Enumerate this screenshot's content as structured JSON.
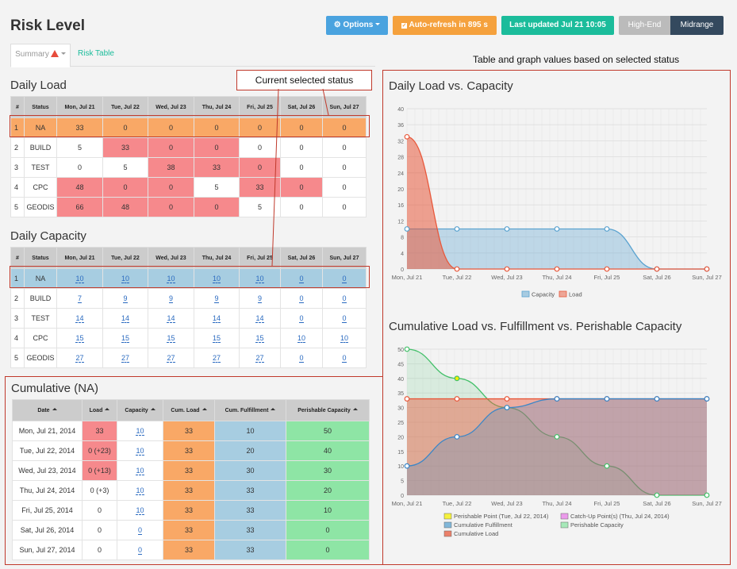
{
  "header": {
    "title": "Risk Level",
    "options_label": "Options",
    "autorefresh_label": "Auto-refresh in 895 s",
    "updated_label": "Last updated Jul 21 10:05",
    "highend_label": "High-End",
    "midrange_label": "Midrange"
  },
  "tabs": {
    "summary": "Summary",
    "risk_table": "Risk Table"
  },
  "annotations": {
    "note": "Table and graph values based on selected status",
    "callout": "Current selected status"
  },
  "daily_load": {
    "title": "Daily Load",
    "columns": [
      "#",
      "Status",
      "Mon, Jul 21",
      "Tue, Jul 22",
      "Wed, Jul 23",
      "Thu, Jul 24",
      "Fri, Jul 25",
      "Sat, Jul 26",
      "Sun, Jul 27"
    ],
    "rows": [
      {
        "n": "1",
        "status": "NA",
        "values": [
          "33",
          "0",
          "0",
          "0",
          "0",
          "0",
          "0"
        ],
        "risk": [
          1,
          1,
          1,
          1,
          1,
          1,
          1
        ]
      },
      {
        "n": "2",
        "status": "BUILD",
        "values": [
          "5",
          "33",
          "0",
          "0",
          "0",
          "0",
          "0"
        ],
        "risk": [
          0,
          1,
          1,
          1,
          0,
          0,
          0
        ]
      },
      {
        "n": "3",
        "status": "TEST",
        "values": [
          "0",
          "5",
          "38",
          "33",
          "0",
          "0",
          "0"
        ],
        "risk": [
          0,
          0,
          1,
          1,
          1,
          0,
          0
        ]
      },
      {
        "n": "4",
        "status": "CPC",
        "values": [
          "48",
          "0",
          "0",
          "5",
          "33",
          "0",
          "0"
        ],
        "risk": [
          1,
          1,
          1,
          0,
          1,
          1,
          0
        ]
      },
      {
        "n": "5",
        "status": "GEODIS",
        "values": [
          "66",
          "48",
          "0",
          "0",
          "5",
          "0",
          "0"
        ],
        "risk": [
          1,
          1,
          1,
          1,
          0,
          0,
          0
        ]
      }
    ]
  },
  "daily_capacity": {
    "title": "Daily Capacity",
    "columns": [
      "#",
      "Status",
      "Mon, Jul 21",
      "Tue, Jul 22",
      "Wed, Jul 23",
      "Thu, Jul 24",
      "Fri, Jul 25",
      "Sat, Jul 26",
      "Sun, Jul 27"
    ],
    "rows": [
      {
        "n": "1",
        "status": "NA",
        "values": [
          "10",
          "10",
          "10",
          "10",
          "10",
          "0",
          "0"
        ]
      },
      {
        "n": "2",
        "status": "BUILD",
        "values": [
          "7",
          "9",
          "9",
          "9",
          "9",
          "0",
          "0"
        ]
      },
      {
        "n": "3",
        "status": "TEST",
        "values": [
          "14",
          "14",
          "14",
          "14",
          "14",
          "0",
          "0"
        ]
      },
      {
        "n": "4",
        "status": "CPC",
        "values": [
          "15",
          "15",
          "15",
          "15",
          "15",
          "10",
          "10"
        ]
      },
      {
        "n": "5",
        "status": "GEODIS",
        "values": [
          "27",
          "27",
          "27",
          "27",
          "27",
          "0",
          "0"
        ]
      }
    ]
  },
  "cumulative": {
    "title": "Cumulative (NA)",
    "columns": [
      "Date",
      "Load",
      "Capacity",
      "Cum. Load",
      "Cum. Fulfillment",
      "Perishable Capacity"
    ],
    "rows": [
      {
        "date": "Mon, Jul 21, 2014",
        "load": "33",
        "capacity": "10",
        "cum_load": "33",
        "cum_fulfillment": "10",
        "perishable": "50",
        "load_risk": 1
      },
      {
        "date": "Tue, Jul 22, 2014",
        "load": "0 (+23)",
        "capacity": "10",
        "cum_load": "33",
        "cum_fulfillment": "20",
        "perishable": "40",
        "load_risk": 1
      },
      {
        "date": "Wed, Jul 23, 2014",
        "load": "0 (+13)",
        "capacity": "10",
        "cum_load": "33",
        "cum_fulfillment": "30",
        "perishable": "30",
        "load_risk": 1
      },
      {
        "date": "Thu, Jul 24, 2014",
        "load": "0 (+3)",
        "capacity": "10",
        "cum_load": "33",
        "cum_fulfillment": "33",
        "perishable": "20",
        "load_risk": 0
      },
      {
        "date": "Fri, Jul 25, 2014",
        "load": "0",
        "capacity": "10",
        "cum_load": "33",
        "cum_fulfillment": "33",
        "perishable": "10",
        "load_risk": 0
      },
      {
        "date": "Sat, Jul 26, 2014",
        "load": "0",
        "capacity": "0",
        "cum_load": "33",
        "cum_fulfillment": "33",
        "perishable": "0",
        "load_risk": 0
      },
      {
        "date": "Sun, Jul 27, 2014",
        "load": "0",
        "capacity": "0",
        "cum_load": "33",
        "cum_fulfillment": "33",
        "perishable": "0",
        "load_risk": 0
      }
    ]
  },
  "chart_data": [
    {
      "type": "area",
      "title": "Daily Load vs. Capacity",
      "categories": [
        "Mon, Jul 21",
        "Tue, Jul 22",
        "Wed, Jul 23",
        "Thu, Jul 24",
        "Fri, Jul 25",
        "Sat, Jul 26",
        "Sun, Jul 27"
      ],
      "ylim": [
        0,
        40
      ],
      "yticks": [
        0,
        4,
        8,
        12,
        16,
        20,
        24,
        28,
        32,
        36,
        40
      ],
      "grid": true,
      "legend_position": "bottom",
      "series": [
        {
          "name": "Capacity",
          "values": [
            10,
            10,
            10,
            10,
            10,
            0,
            0
          ],
          "color": "#5ba3d0"
        },
        {
          "name": "Load",
          "values": [
            33,
            0,
            0,
            0,
            0,
            0,
            0
          ],
          "color": "#e8593c"
        }
      ]
    },
    {
      "type": "area",
      "title": "Cumulative Load vs. Fulfillment vs. Perishable Capacity",
      "categories": [
        "Mon, Jul 21",
        "Tue, Jul 22",
        "Wed, Jul 23",
        "Thu, Jul 24",
        "Fri, Jul 25",
        "Sat, Jul 26",
        "Sun, Jul 27"
      ],
      "ylim": [
        0,
        50
      ],
      "yticks": [
        0,
        5,
        10,
        15,
        20,
        25,
        30,
        35,
        40,
        45,
        50
      ],
      "grid": true,
      "legend_position": "bottom",
      "series": [
        {
          "name": "Perishable Capacity",
          "values": [
            50,
            40,
            30,
            20,
            10,
            0,
            0
          ],
          "color": "#44c06a"
        },
        {
          "name": "Cumulative Load",
          "values": [
            33,
            33,
            33,
            33,
            33,
            33,
            33
          ],
          "color": "#e8593c"
        },
        {
          "name": "Cumulative Fulfillment",
          "values": [
            10,
            20,
            30,
            33,
            33,
            33,
            33
          ],
          "color": "#3a86c8"
        }
      ],
      "markers": [
        {
          "name": "Perishable Point (Tue, Jul 22, 2014)",
          "color": "#f5f000"
        },
        {
          "name": "Catch-Up Point(s) (Thu, Jul 24, 2014)",
          "color": "#e87ee8"
        }
      ],
      "legend": [
        "Perishable Point (Tue, Jul 22, 2014)",
        "Catch-Up Point(s) (Thu, Jul 24, 2014)",
        "Cumulative Fulfillment",
        "Perishable Capacity",
        "Cumulative Load"
      ]
    }
  ]
}
